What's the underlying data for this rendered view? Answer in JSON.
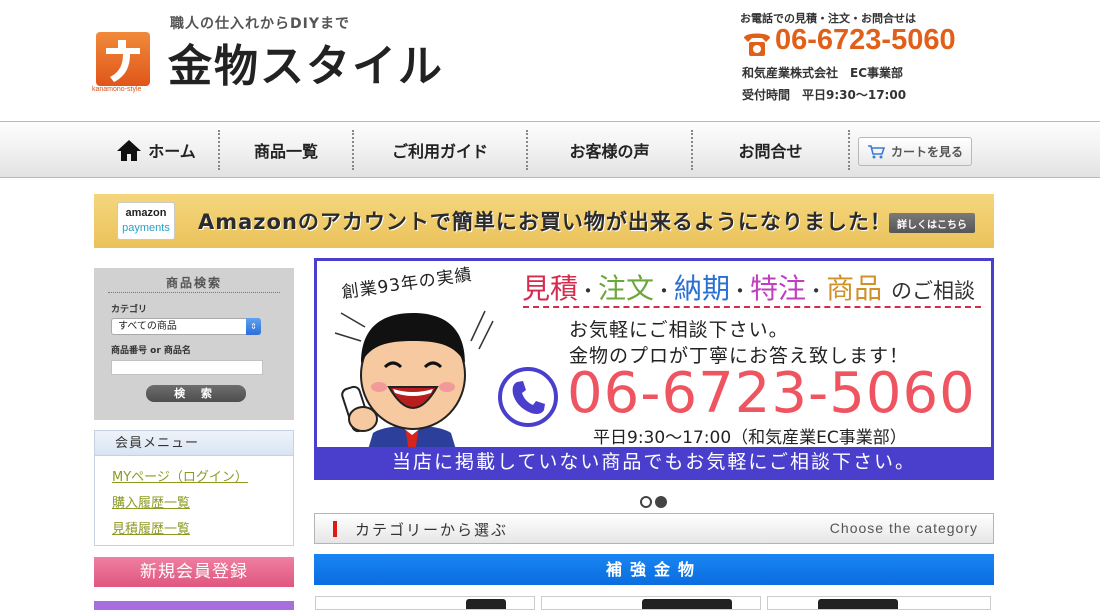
{
  "header": {
    "tagline": "職人の仕入れからDIYまで",
    "logo_text": "金物スタイル",
    "logo_sub": "kanamono-style",
    "phone_note": "お電話での見積・注文・お問合せは",
    "phone_number": "06-6723-5060",
    "company": "和気産業株式会社　EC事業部",
    "hours": "受付時間　平日9:30〜17:00"
  },
  "nav": {
    "items": [
      {
        "label": "ホーム"
      },
      {
        "label": "商品一覧"
      },
      {
        "label": "ご利用ガイド"
      },
      {
        "label": "お客様の声"
      },
      {
        "label": "お問合せ"
      }
    ],
    "cart_label": "カートを見る"
  },
  "amazon_banner": {
    "badge_line1": "amazon",
    "badge_line2": "payments",
    "message": "Amazonのアカウントで簡単にお買い物が出来るようになりました！",
    "detail_label": "詳しくはこちら"
  },
  "search": {
    "title": "商品検索",
    "category_label": "カテゴリ",
    "category_selected": "すべての商品",
    "keyword_label": "商品番号 or 商品名",
    "keyword_value": "",
    "button_label": "検 索"
  },
  "member": {
    "title": "会員メニュー",
    "links": [
      {
        "label": "MYページ（ログイン）"
      },
      {
        "label": "購入履歴一覧"
      },
      {
        "label": "見積履歴一覧"
      }
    ]
  },
  "register_label": "新規会員登録",
  "hero": {
    "years": "創業93年の実績",
    "consult_items": [
      "見積",
      "注文",
      "納期",
      "特注",
      "商品"
    ],
    "consult_suffix": "のご相談",
    "message1": "お気軽にご相談下さい。",
    "message2": "金物のプロが丁寧にお答え致します！",
    "phone": "06-6723-5060",
    "hours": "平日9:30〜17:00（和気産業EC事業部）",
    "bottom": "当店に掲載していない商品でもお気軽にご相談下さい。"
  },
  "slider": {
    "count": 2,
    "active": 1
  },
  "category_heading": {
    "jp": "カテゴリーから選ぶ",
    "en": "Choose the category"
  },
  "category_first": "補強金物",
  "colors": {
    "brand_orange": "#e0601a",
    "hero_purple": "#4a3fcc",
    "category_blue": "#0a6de0",
    "register_pink": "#e0567f",
    "member_link": "#8c9a22"
  }
}
